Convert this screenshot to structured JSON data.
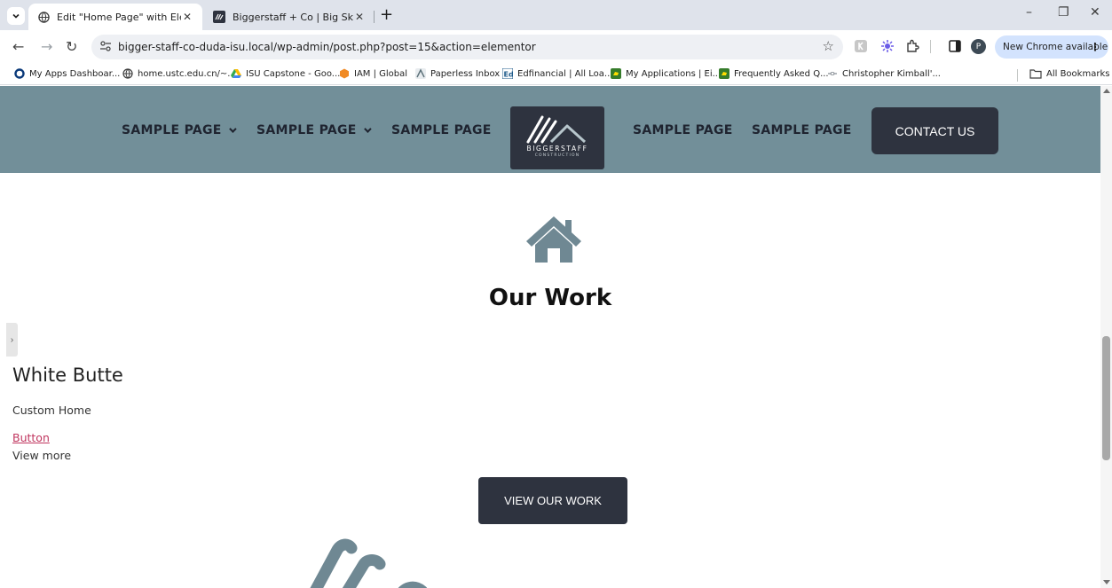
{
  "browser": {
    "tabs": [
      {
        "title": "Edit \"Home Page\" with Elementor",
        "close": "✕",
        "active": true
      },
      {
        "title": "Biggerstaff + Co | Big Sky Montana",
        "close": "✕",
        "active": false
      }
    ],
    "new_tab": "+",
    "window_controls": {
      "minimize": "–",
      "restore": "❐",
      "close": "✕"
    },
    "nav": {
      "back": "←",
      "forward": "→",
      "reload": "↻"
    },
    "url": "bigger-staff-co-duda-isu.local/wp-admin/post.php?post=15&action=elementor",
    "bookmark_star": "☆",
    "profile_initial": "P",
    "update_label": "New Chrome available",
    "update_menu": "⋮",
    "bookmarks": [
      {
        "label": "My Apps Dashboar...",
        "icon": "circle-o-icon"
      },
      {
        "label": "home.ustc.edu.cn/~...",
        "icon": "globe-icon"
      },
      {
        "label": "ISU Capstone - Goo...",
        "icon": "google-drive-icon"
      },
      {
        "label": "IAM | Global",
        "icon": "hex-icon"
      },
      {
        "label": "Paperless Inbox",
        "icon": "paperless-icon"
      },
      {
        "label": "Edfinancial | All Loa...",
        "icon": "ed-icon"
      },
      {
        "label": "My Applications | Ei...",
        "icon": "deere-icon"
      },
      {
        "label": "Frequently Asked Q...",
        "icon": "deere-icon"
      },
      {
        "label": "Christopher Kimball'...",
        "icon": "link-icon"
      }
    ],
    "all_bookmarks": "All Bookmarks"
  },
  "site": {
    "menu": [
      {
        "label": "SAMPLE PAGE",
        "has_dropdown": true
      },
      {
        "label": "SAMPLE PAGE",
        "has_dropdown": true
      },
      {
        "label": "SAMPLE PAGE",
        "has_dropdown": false
      },
      {
        "label": "SAMPLE PAGE",
        "has_dropdown": false
      },
      {
        "label": "SAMPLE PAGE",
        "has_dropdown": false
      }
    ],
    "logo": {
      "name": "BIGGERSTAFF",
      "sub": "CONSTRUCTION"
    },
    "contact_label": "CONTACT US",
    "section_title": "Our Work",
    "project": {
      "title": "White Butte",
      "subtitle": "Custom Home",
      "link": "Button",
      "more": "View more"
    },
    "cta_label": "VIEW OUR WORK",
    "side_toggle": "›"
  },
  "colors": {
    "header_bg": "#728f99",
    "dark": "#2e333f",
    "accent_link": "#c0365f",
    "icon_slate": "#6f8893"
  }
}
